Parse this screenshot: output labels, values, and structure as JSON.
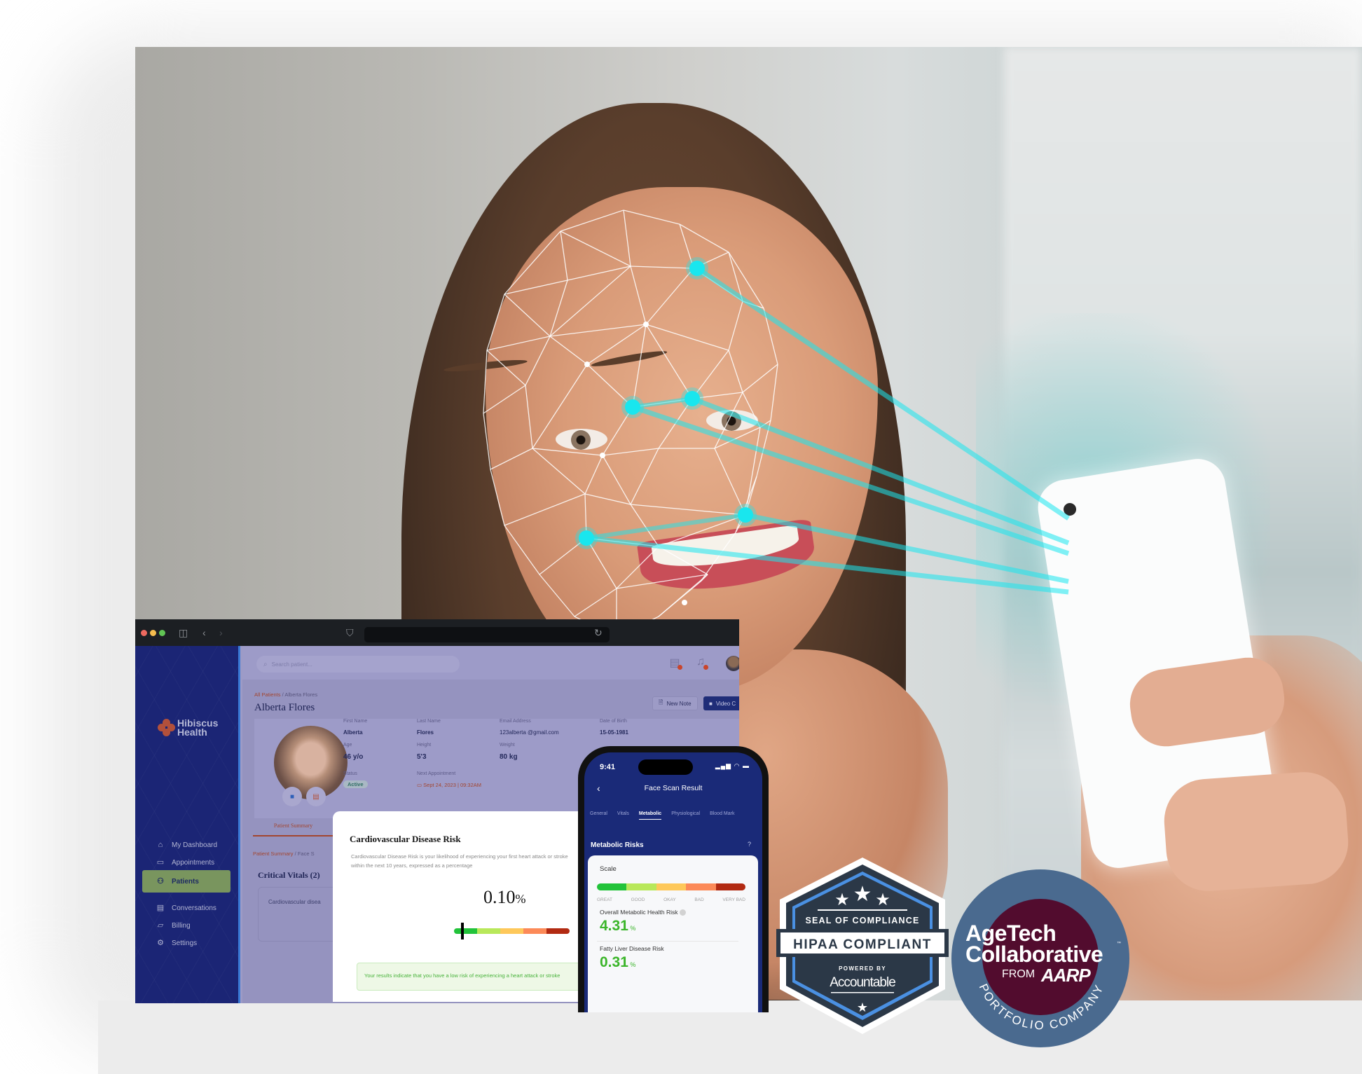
{
  "browser": {
    "traffic_lights": [
      "#ee6a5f",
      "#f5bd4f",
      "#61c454"
    ]
  },
  "app": {
    "brand": {
      "line1": "Hibiscus",
      "line2": "Health"
    },
    "search_placeholder": "Search patient...",
    "sidebar": {
      "items": [
        {
          "label": "My Dashboard",
          "icon": "home-icon",
          "glyph": "⌂"
        },
        {
          "label": "Appointments",
          "icon": "calendar-icon",
          "glyph": "▭"
        },
        {
          "label": "Patients",
          "icon": "patients-icon",
          "glyph": "⚇",
          "active": true
        },
        {
          "label": "Conversations",
          "icon": "chat-icon",
          "glyph": "▤"
        },
        {
          "label": "Billing",
          "icon": "wallet-icon",
          "glyph": "▱"
        },
        {
          "label": "Settings",
          "icon": "gear-icon",
          "glyph": "⚙"
        }
      ]
    },
    "breadcrumb": {
      "root": "All Patients",
      "sep": "/",
      "current": "Alberta Flores"
    },
    "page_title": "Alberta Flores",
    "actions": {
      "new_note": "New Note",
      "video_call": "Video C"
    },
    "patient": {
      "first_name": {
        "label": "First Name",
        "value": "Alberta"
      },
      "last_name": {
        "label": "Last Name",
        "value": "Flores"
      },
      "email": {
        "label": "Email Address",
        "value": "123alberta @gmail.com"
      },
      "dob": {
        "label": "Date of Birth",
        "value": "15-05-1981"
      },
      "age": {
        "label": "Age",
        "value": "46 y/o"
      },
      "height": {
        "label": "Height",
        "value": "5'3"
      },
      "weight": {
        "label": "Weight",
        "value": "80 kg"
      },
      "status": {
        "label": "Status",
        "value": "Active"
      },
      "next_appointment": {
        "label": "Next Appointment",
        "value": "Sept 24, 2023 | 09:32AM"
      }
    },
    "subtab": "Patient Summary",
    "breadcrumb2": {
      "root": "Patient Summary",
      "sep": "/",
      "current": "Face S"
    },
    "critical_vitals_title": "Critical Vitals (2)",
    "critical_card_label": "Cardiovascular disea"
  },
  "cvd_card": {
    "title": "Cardiovascular Disease Risk",
    "description_line1": "Cardiovascular Disease Risk is your likelihood of experiencing your first heart attack or stroke",
    "description_line2": "within the next 10 years, expressed as a percentage",
    "value": "0.10",
    "unit": "%",
    "risk_fraction": 0.03,
    "result_text": "Your results indicate that you have a low risk of experiencing a heart attack or stroke"
  },
  "scale_colors": [
    "#22c33a",
    "#b8e85a",
    "#fec85a",
    "#fc8a58",
    "#b22a12"
  ],
  "phone": {
    "time": "9:41",
    "status_icons": "signal wifi battery",
    "title": "Face Scan Result",
    "tabs": [
      "General",
      "Vitals",
      "Metabolic",
      "Physiological",
      "Blood Mark"
    ],
    "active_tab": "Metabolic",
    "section_title": "Metabolic Risks",
    "scale_label": "Scale",
    "scale_levels": [
      "GREAT",
      "GOOD",
      "OKAY",
      "BAD",
      "VERY BAD"
    ],
    "risks": [
      {
        "name": "Overall Metabolic Health Risk",
        "value": "4.31",
        "unit": "%",
        "info": true
      },
      {
        "name": "Fatty Liver Disease Risk",
        "value": "0.31",
        "unit": "%",
        "info": false
      }
    ]
  },
  "badges": {
    "hipaa": {
      "seal": "SEAL OF COMPLIANCE",
      "main": "HIPAA COMPLIANT",
      "powered": "POWERED BY",
      "brand": "Accountable"
    },
    "aarp": {
      "line1": "AgeTech",
      "line2": "Collaborative",
      "tm": "™",
      "from": "FROM",
      "org": "AARP",
      "ring": "PORTFOLIO COMPANY"
    }
  },
  "colors": {
    "scan_cyan": "#19e6ee",
    "sidebar_navy": "#1b2575",
    "accent_red": "#a2452f",
    "phone_navy": "#1a2a78",
    "risk_green": "#3bb52a"
  }
}
